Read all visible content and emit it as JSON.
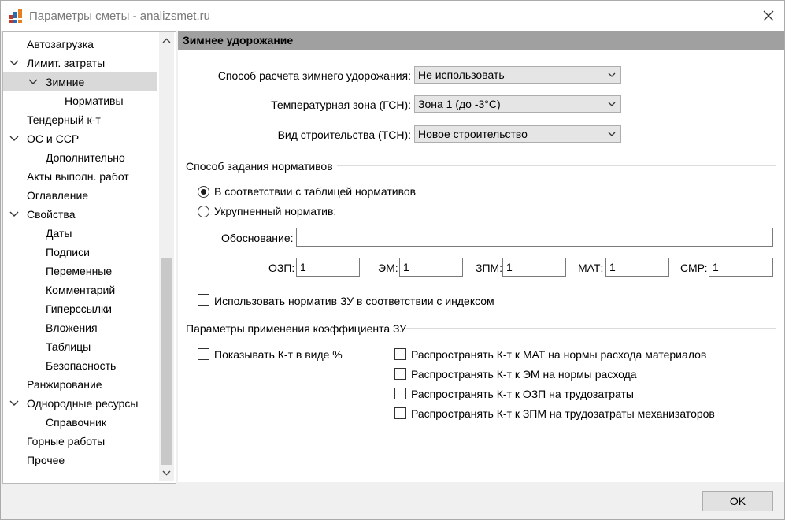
{
  "window": {
    "title": "Параметры сметы - analizsmet.ru"
  },
  "tree": [
    {
      "label": "Автозагрузка"
    },
    {
      "label": "Лимит. затраты"
    },
    {
      "label": "Зимние"
    },
    {
      "label": "Нормативы"
    },
    {
      "label": "Тендерный к-т"
    },
    {
      "label": "ОС и ССР"
    },
    {
      "label": "Дополнительно"
    },
    {
      "label": "Акты выполн. работ"
    },
    {
      "label": "Оглавление"
    },
    {
      "label": "Свойства"
    },
    {
      "label": "Даты"
    },
    {
      "label": "Подписи"
    },
    {
      "label": "Переменные"
    },
    {
      "label": "Комментарий"
    },
    {
      "label": "Гиперссылки"
    },
    {
      "label": "Вложения"
    },
    {
      "label": "Таблицы"
    },
    {
      "label": "Безопасность"
    },
    {
      "label": "Ранжирование"
    },
    {
      "label": "Однородные ресурсы"
    },
    {
      "label": "Справочник"
    },
    {
      "label": "Горные работы"
    },
    {
      "label": "Прочее"
    }
  ],
  "section": {
    "title": "Зимнее удорожание"
  },
  "fields": {
    "method": {
      "label": "Способ расчета зимнего удорожания:",
      "value": "Не использовать"
    },
    "zone": {
      "label": "Температурная зона (ГСН):",
      "value": "Зона 1 (до -3°С)"
    },
    "build_type": {
      "label": "Вид строительства (ТСН):",
      "value": "Новое строительство"
    }
  },
  "norms_group": {
    "title": "Способ задания нормативов",
    "radio_table": "В соответствии с таблицей нормативов",
    "radio_aggregated": "Укрупненный норматив:",
    "justification_label": "Обоснование:",
    "justification_value": "",
    "coefs": [
      {
        "label": "ОЗП:",
        "value": "1"
      },
      {
        "label": "ЭМ:",
        "value": "1"
      },
      {
        "label": "ЗПМ:",
        "value": "1"
      },
      {
        "label": "МАТ:",
        "value": "1"
      },
      {
        "label": "СМР:",
        "value": "1"
      }
    ],
    "use_index_checkbox": "Использовать норматив ЗУ в соответствии с индексом"
  },
  "apply_group": {
    "title": "Параметры применения коэффициента ЗУ",
    "show_percent": "Показывать К-т в виде %",
    "spread": [
      "Распространять К-т к МАТ на нормы расхода материалов",
      "Распространять К-т к ЭМ на нормы расхода",
      "Распространять К-т к ОЗП на трудозатраты",
      "Распространять К-т к ЗПМ на трудозатраты механизаторов"
    ]
  },
  "footer": {
    "ok_label": "OK"
  },
  "colors": {
    "header_bg": "#a0a0a0",
    "selected_bg": "#d9d9d9",
    "window_bg": "#f0f0f0"
  },
  "icons": {
    "app": "app-grid-icon",
    "close": "close-icon",
    "expand": "chevron-down-icon",
    "collapse": "chevron-right-icon"
  }
}
